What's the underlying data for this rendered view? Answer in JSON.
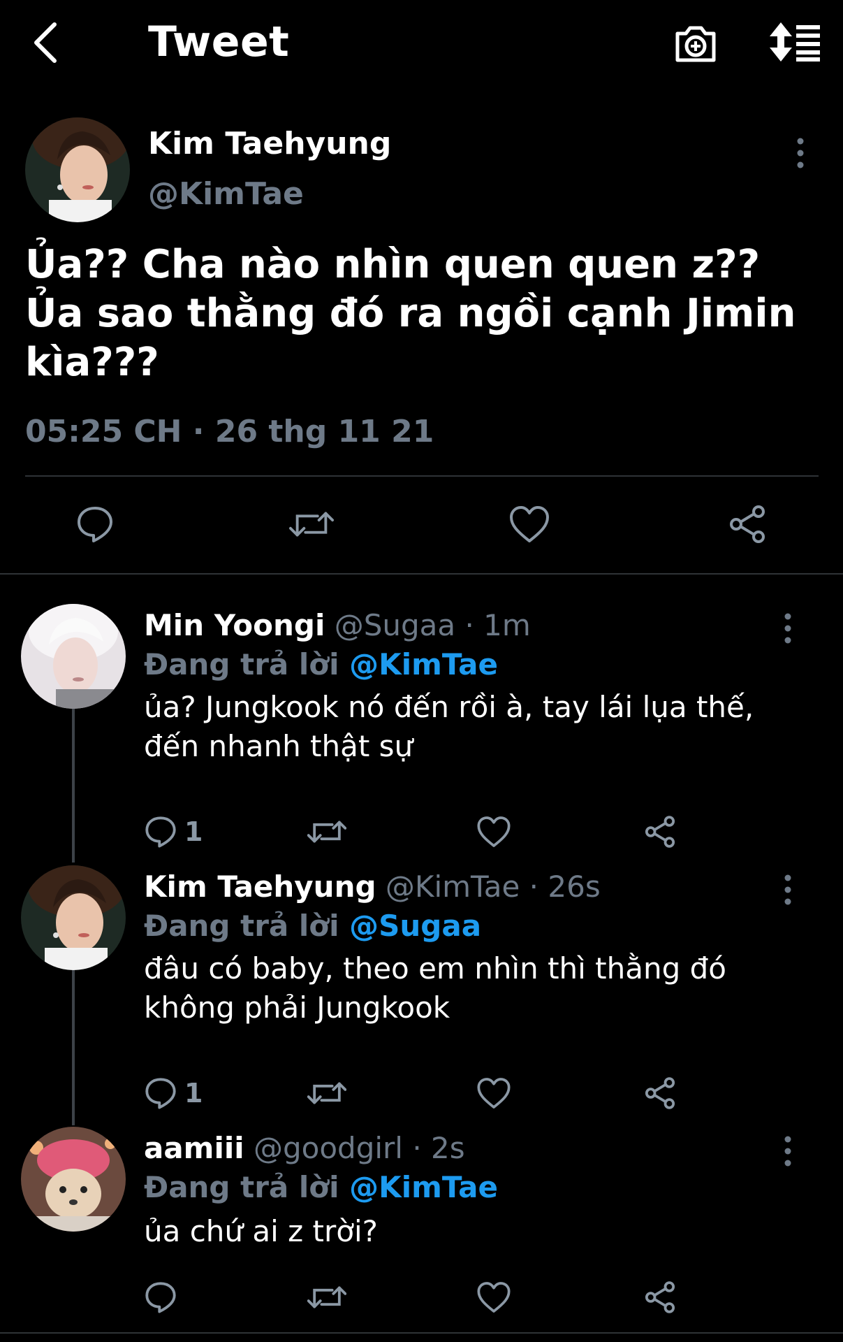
{
  "header": {
    "title": "Tweet"
  },
  "main_tweet": {
    "author_name": "Kim Taehyung",
    "author_handle": "@KimTae",
    "text": "Ủa?? Cha nào nhìn quen quen z?? Ủa sao thằng đó ra ngồi cạnh Jimin kìa???",
    "timestamp": "05:25 CH · 26 thg 11 21"
  },
  "replies": [
    {
      "author_name": "Min Yoongi",
      "author_handle": "@Sugaa",
      "time": "· 1m",
      "replying_prefix": "Đang trả lời",
      "replying_to": "@KimTae",
      "text": "ủa? Jungkook nó đến rồi à, tay lái lụa thế, đến nhanh thật sự",
      "reply_count": "1"
    },
    {
      "author_name": "Kim Taehyung",
      "author_handle": "@KimTae",
      "time": "· 26s",
      "replying_prefix": "Đang trả lời",
      "replying_to": "@Sugaa",
      "text": "đâu có baby, theo em nhìn thì thằng đó không phải Jungkook",
      "reply_count": "1"
    },
    {
      "author_name": "aamiii",
      "author_handle": "@goodgirl",
      "time": "· 2s",
      "replying_prefix": "Đang trả lời",
      "replying_to": "@KimTae",
      "text": "ủa chứ ai z trời?",
      "reply_count": ""
    }
  ],
  "colors": {
    "background": "#000000",
    "text_primary": "#ffffff",
    "text_secondary": "#6e7a88",
    "link": "#1d9bf0",
    "divider": "#2f3336"
  },
  "icons": [
    "back-arrow-icon",
    "camera-plus-icon",
    "sort-icon",
    "more-vertical-icon",
    "reply-icon",
    "retweet-icon",
    "like-icon",
    "share-icon"
  ]
}
